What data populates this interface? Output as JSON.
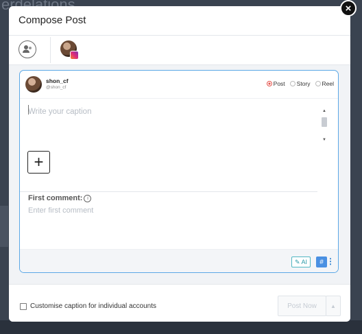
{
  "background": {
    "title": "erdelations"
  },
  "modal": {
    "title": "Compose Post",
    "close_label": "×"
  },
  "account": {
    "name": "shon_cf",
    "handle": "@shon_cf"
  },
  "post_types": [
    {
      "label": "Post",
      "selected": true
    },
    {
      "label": "Story",
      "selected": false
    },
    {
      "label": "Reel",
      "selected": false
    }
  ],
  "caption": {
    "placeholder": "Write your caption"
  },
  "add_media_label": "+",
  "first_comment": {
    "label": "First comment:",
    "info_icon": "i",
    "placeholder": "Enter first comment"
  },
  "tools": {
    "ai_label": "AI",
    "ai_icon": "✎",
    "hashtag_label": "#",
    "more_label": "⋮"
  },
  "footer": {
    "customise_label": "Customise caption for individual accounts",
    "post_now_label": "Post Now",
    "post_caret": "▲"
  },
  "colors": {
    "accent": "#4a90e2",
    "editor_border": "#5aa7e6",
    "selected_radio": "#e5534b"
  }
}
